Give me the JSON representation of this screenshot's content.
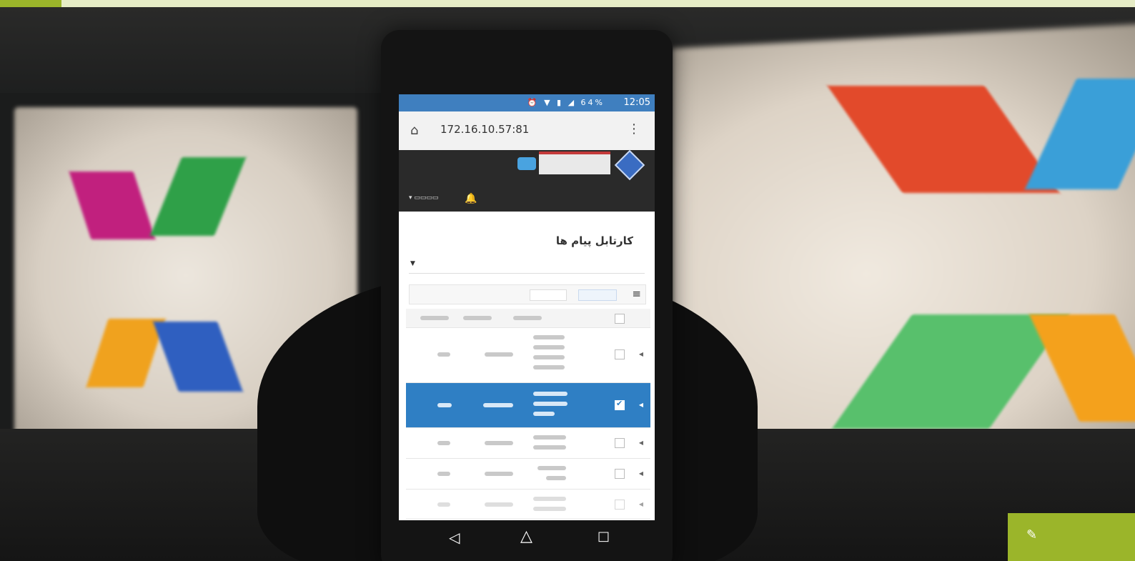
{
  "screen": {
    "status_bar": {
      "battery": "64%",
      "time": "12:05"
    },
    "browser": {
      "url": "172.16.10.57:81"
    },
    "page": {
      "title": "کارتابل پیام ها"
    }
  },
  "colors": {
    "brand_green": "#9bb52a",
    "status_blue": "#3f7fbf",
    "row_highlight": "#2f7fc4"
  },
  "icons": [
    "home-icon",
    "menu-icon",
    "bell-icon",
    "back-icon",
    "home-nav-icon",
    "recent-apps-icon",
    "pen-icon"
  ]
}
